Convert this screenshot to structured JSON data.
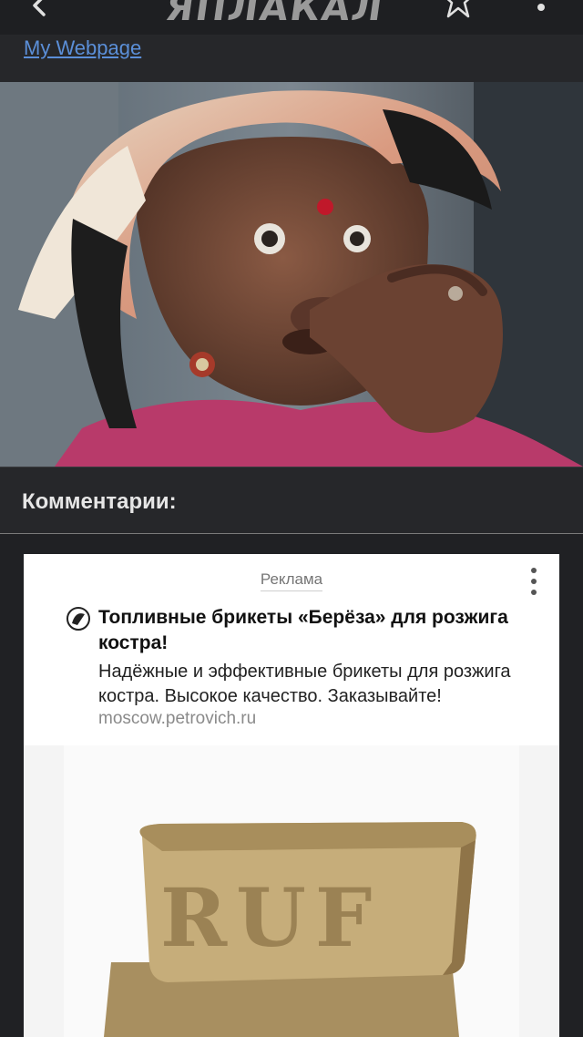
{
  "header": {
    "logo_text": "ЯПЛАКАЛ"
  },
  "webpage_link": "My Webpage",
  "comments_title": "Комментарии:",
  "ad": {
    "label": "Реклама",
    "title": "Топливные брикеты «Берёза» для розжига костра!",
    "description": "Надёжные и эффективные брикеты для розжига костра. Высокое качество. Заказывайте!",
    "domain": "moscow.petrovich.ru",
    "image_text": "RUF"
  },
  "colors": {
    "background": "#202124",
    "link": "#5b8fd8",
    "ad_bg": "#ffffff"
  }
}
